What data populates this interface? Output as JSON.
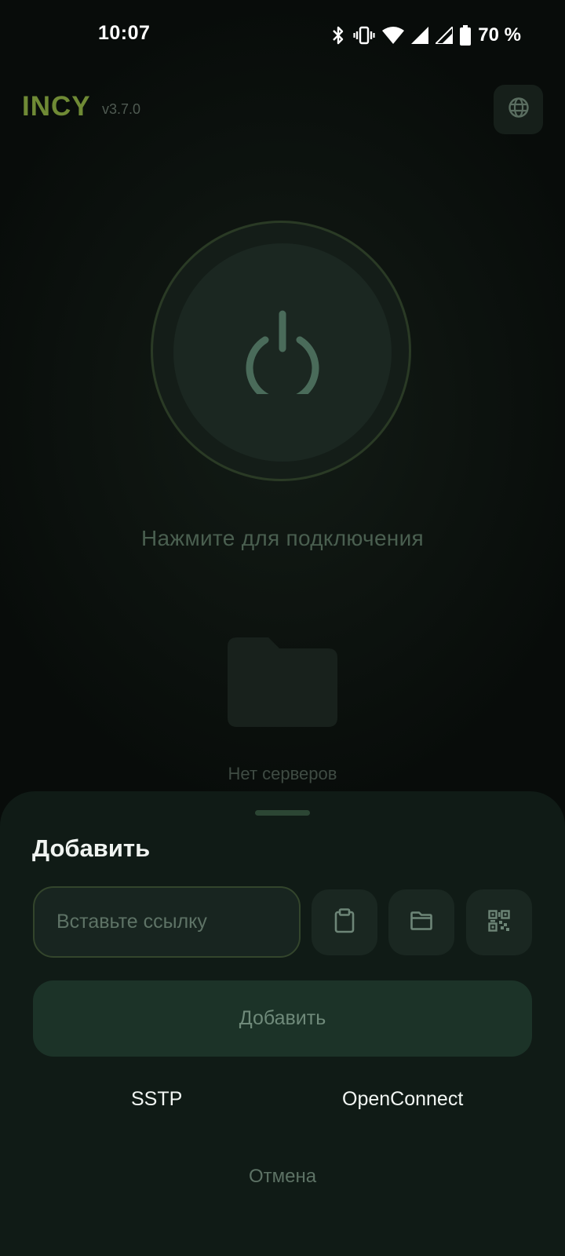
{
  "status_bar": {
    "time": "10:07",
    "battery": "70 %",
    "icons": [
      "bluetooth-icon",
      "vibrate-icon",
      "wifi-icon",
      "signal-icon",
      "signal-icon",
      "battery-icon"
    ]
  },
  "header": {
    "app_name": "INCY",
    "version": "v3.7.0",
    "language_icon": "globe-icon"
  },
  "main": {
    "power_icon": "power-icon",
    "connect_hint": "Нажмите для подключения",
    "empty_icon": "folder-icon",
    "empty_text": "Нет серверов"
  },
  "sheet": {
    "title": "Добавить",
    "link_placeholder": "Вставьте ссылку",
    "link_value": "",
    "actions": [
      "clipboard-icon",
      "folder-icon",
      "qr-code-icon"
    ],
    "add_label": "Добавить",
    "protocols": [
      "SSTP",
      "OpenConnect"
    ],
    "cancel_label": "Отмена"
  },
  "colors": {
    "brand": "#6f8a35",
    "background": "#080c0a",
    "sheet": "#101b16",
    "accent_dim": "#4a5f50"
  }
}
